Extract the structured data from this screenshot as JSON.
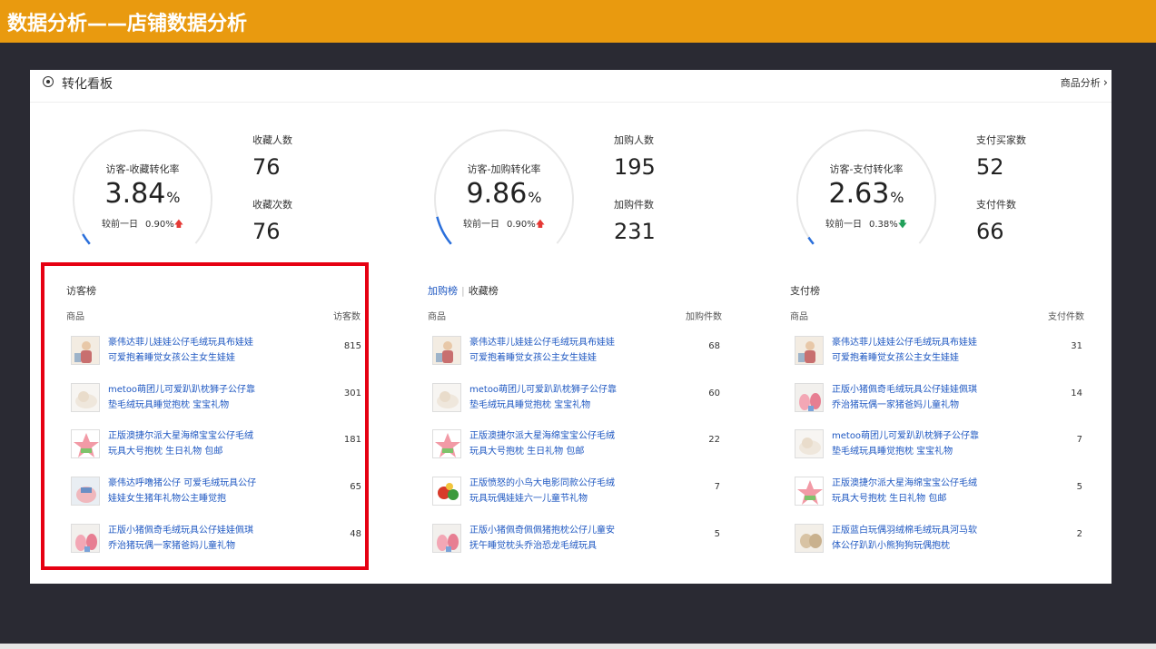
{
  "slide": {
    "title": "数据分析——店铺数据分析"
  },
  "board": {
    "title": "转化看板",
    "link": "商品分析",
    "link_chevron": "›"
  },
  "stats": [
    {
      "gauge_label": "访客-收藏转化率",
      "value": "3.84",
      "unit": "%",
      "compare_label": "较前一日",
      "compare_value": "0.90%",
      "trend": "up",
      "progress": 0.0384,
      "metrics": [
        {
          "label": "收藏人数",
          "value": "76"
        },
        {
          "label": "收藏次数",
          "value": "76"
        }
      ]
    },
    {
      "gauge_label": "访客-加购转化率",
      "value": "9.86",
      "unit": "%",
      "compare_label": "较前一日",
      "compare_value": "0.90%",
      "trend": "up",
      "progress": 0.0986,
      "metrics": [
        {
          "label": "加购人数",
          "value": "195"
        },
        {
          "label": "加购件数",
          "value": "231"
        }
      ]
    },
    {
      "gauge_label": "访客-支付转化率",
      "value": "2.63",
      "unit": "%",
      "compare_label": "较前一日",
      "compare_value": "0.38%",
      "trend": "down",
      "progress": 0.0263,
      "metrics": [
        {
          "label": "支付买家数",
          "value": "52"
        },
        {
          "label": "支付件数",
          "value": "66"
        }
      ]
    }
  ],
  "arrows": {
    "up": "🡅",
    "down": "🡇"
  },
  "rankings": [
    {
      "title": "访客榜",
      "col_product": "商品",
      "col_value": "访客数",
      "rows": [
        {
          "line1": "豪伟达菲儿娃娃公仔毛绒玩具布娃娃",
          "line2": "可爱抱着睡觉女孩公主女生娃娃",
          "value": "815",
          "thumb": "doll-girl"
        },
        {
          "line1": "metoo萌团儿可爱趴趴枕狮子公仔靠",
          "line2": "垫毛绒玩具睡觉抱枕 宝宝礼物",
          "value": "301",
          "thumb": "lion-pillow"
        },
        {
          "line1": "正版澳捷尔派大星海绵宝宝公仔毛绒",
          "line2": "玩具大号抱枕 生日礼物 包邮",
          "value": "181",
          "thumb": "patrick-star"
        },
        {
          "line1": "豪伟达呼噜猪公仔 可爱毛绒玩具公仔",
          "line2": "娃娃女生猪年礼物公主睡觉抱",
          "value": "65",
          "thumb": "pig-plush"
        },
        {
          "line1": "正版小猪佩奇毛绒玩具公仔娃娃佩琪",
          "line2": "乔治猪玩偶一家猪爸妈儿童礼物",
          "value": "48",
          "thumb": "peppa-family"
        }
      ]
    },
    {
      "title": "加购榜",
      "title2": "收藏榜",
      "col_product": "商品",
      "col_value": "加购件数",
      "rows": [
        {
          "line1": "豪伟达菲儿娃娃公仔毛绒玩具布娃娃",
          "line2": "可爱抱着睡觉女孩公主女生娃娃",
          "value": "68",
          "thumb": "doll-girl"
        },
        {
          "line1": "metoo萌团儿可爱趴趴枕狮子公仔靠",
          "line2": "垫毛绒玩具睡觉抱枕 宝宝礼物",
          "value": "60",
          "thumb": "lion-pillow"
        },
        {
          "line1": "正版澳捷尔派大星海绵宝宝公仔毛绒",
          "line2": "玩具大号抱枕 生日礼物 包邮",
          "value": "22",
          "thumb": "patrick-star"
        },
        {
          "line1": "正版愤怒的小鸟大电影同款公仔毛绒",
          "line2": "玩具玩偶娃娃六一儿童节礼物",
          "value": "7",
          "thumb": "angry-birds"
        },
        {
          "line1": "正版小猪佩奇佩佩猪抱枕公仔儿童安",
          "line2": "抚午睡觉枕头乔治恐龙毛绒玩具",
          "value": "5",
          "thumb": "peppa-family"
        }
      ]
    },
    {
      "title": "支付榜",
      "col_product": "商品",
      "col_value": "支付件数",
      "rows": [
        {
          "line1": "豪伟达菲儿娃娃公仔毛绒玩具布娃娃",
          "line2": "可爱抱着睡觉女孩公主女生娃娃",
          "value": "31",
          "thumb": "doll-girl"
        },
        {
          "line1": "正版小猪佩奇毛绒玩具公仔娃娃佩琪",
          "line2": "乔治猪玩偶一家猪爸妈儿童礼物",
          "value": "14",
          "thumb": "peppa-family"
        },
        {
          "line1": "metoo萌团儿可爱趴趴枕狮子公仔靠",
          "line2": "垫毛绒玩具睡觉抱枕 宝宝礼物",
          "value": "7",
          "thumb": "lion-pillow"
        },
        {
          "line1": "正版澳捷尔派大星海绵宝宝公仔毛绒",
          "line2": "玩具大号抱枕 生日礼物 包邮",
          "value": "5",
          "thumb": "patrick-star"
        },
        {
          "line1": "正版蓝白玩偶羽绒棉毛绒玩具河马软",
          "line2": "体公仔趴趴小熊狗狗玩偶抱枕",
          "value": "2",
          "thumb": "hippo-plush"
        }
      ]
    }
  ],
  "colors": {
    "accent_bar": "#e99a0f",
    "link": "#1f58c2",
    "gauge_arc": "#2a6fdb",
    "highlight": "#e60012"
  }
}
